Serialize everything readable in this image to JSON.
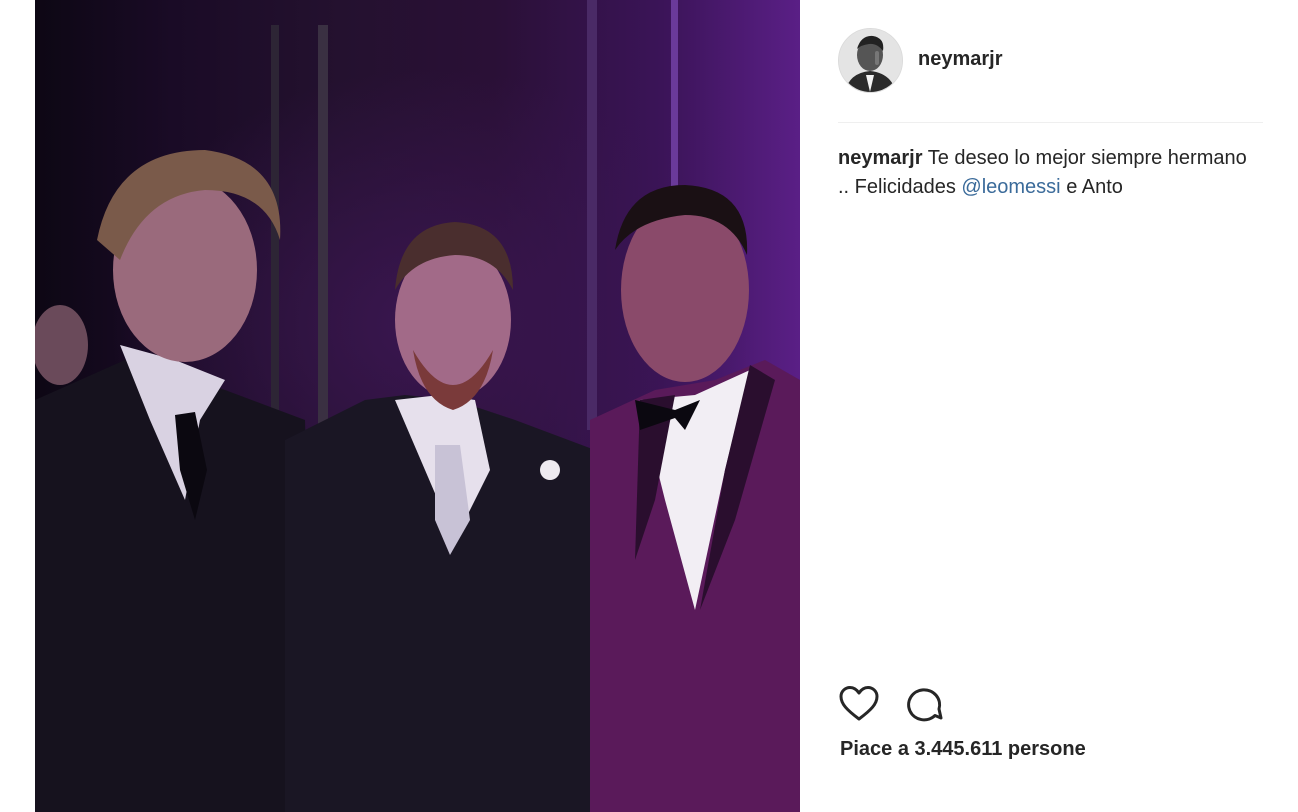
{
  "photo": {
    "subject": "three-men-in-suits-photo",
    "icon": "photo-image"
  },
  "header": {
    "username": "neymarjr",
    "avatar_icon": "profile-avatar"
  },
  "caption": {
    "username": "neymarjr",
    "text_before": "Te deseo lo mejor siempre hermano .. Felicidades",
    "mention": "@leomessi",
    "text_after": "e Anto"
  },
  "actions": {
    "like_icon": "heart-outline-icon",
    "comment_icon": "comment-bubble-icon"
  },
  "likes": {
    "text": "Piace a 3.445.611 persone"
  },
  "colors": {
    "photo_tint": "#5a1f86",
    "mention_link": "#3b6b9a",
    "text": "#262626",
    "divider": "#efefef"
  }
}
